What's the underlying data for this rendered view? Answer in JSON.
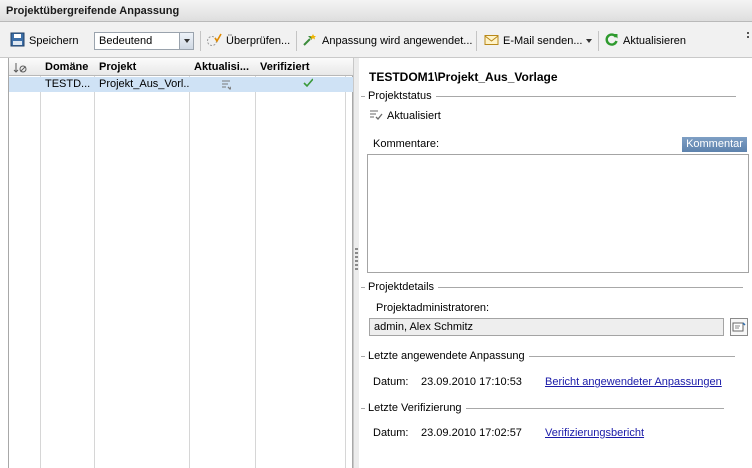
{
  "window": {
    "title": "Projektübergreifende Anpassung"
  },
  "toolbar": {
    "save_label": "Speichern",
    "priority_value": "Bedeutend",
    "verify_label": "Überprüfen...",
    "apply_label": "Anpassung wird angewendet...",
    "email_label": "E-Mail senden...",
    "refresh_label": "Aktualisieren"
  },
  "grid": {
    "columns": [
      "Domäne",
      "Projekt",
      "Aktualisi...",
      "Verifiziert"
    ],
    "rows": [
      {
        "domain": "TESTD...",
        "project": "Projekt_Aus_Vorl...",
        "updated_icon": "updated-icon",
        "verified_icon": "checkmark-icon"
      }
    ]
  },
  "detail": {
    "title": "TESTDOM1\\Projekt_Aus_Vorlage",
    "status_section": "Projektstatus",
    "status_value": "Aktualisiert",
    "comments_label": "Kommentare:",
    "comment_button": "Kommentar",
    "details_section": "Projektdetails",
    "admins_label": "Projektadministratoren:",
    "admins_value": "admin, Alex Schmitz",
    "last_applied_section": "Letzte angewendete Anpassung",
    "last_applied_date_label": "Datum:",
    "last_applied_date": "23.09.2010 17:10:53",
    "last_applied_link": "Bericht angewendeter Anpassungen",
    "last_verify_section": "Letzte Verifizierung",
    "last_verify_date_label": "Datum:",
    "last_verify_date": "23.09.2010 17:02:57",
    "last_verify_link": "Verifizierungsbericht"
  },
  "colors": {
    "selection": "#cfe2f5",
    "button": "#5d82ad",
    "link": "#1a1aa8",
    "check": "#3a9a3a"
  }
}
